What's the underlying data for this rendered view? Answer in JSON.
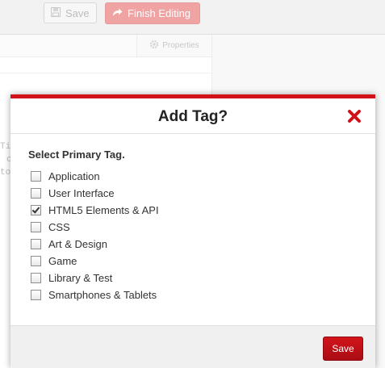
{
  "toolbar": {
    "save_label": "Save",
    "finish_label": "Finish Editing"
  },
  "panel": {
    "properties_label": "Properties",
    "code_fragments": [
      "Ti",
      "c",
      "to"
    ]
  },
  "modal": {
    "title": "Add Tag?",
    "section_label": "Select Primary Tag.",
    "tags": [
      {
        "label": "Application",
        "checked": false
      },
      {
        "label": "User Interface",
        "checked": false
      },
      {
        "label": "HTML5 Elements & API",
        "checked": true
      },
      {
        "label": "CSS",
        "checked": false
      },
      {
        "label": "Art & Design",
        "checked": false
      },
      {
        "label": "Game",
        "checked": false
      },
      {
        "label": "Library & Test",
        "checked": false
      },
      {
        "label": "Smartphones & Tablets",
        "checked": false
      }
    ],
    "save_label": "Save"
  },
  "colors": {
    "accent": "#d2121a",
    "finish_button": "#f0a3a3"
  },
  "icons": {
    "save": "floppy-disk-icon",
    "finish": "redo-arrow-icon",
    "properties": "gear-icon",
    "close": "close-x-icon"
  }
}
